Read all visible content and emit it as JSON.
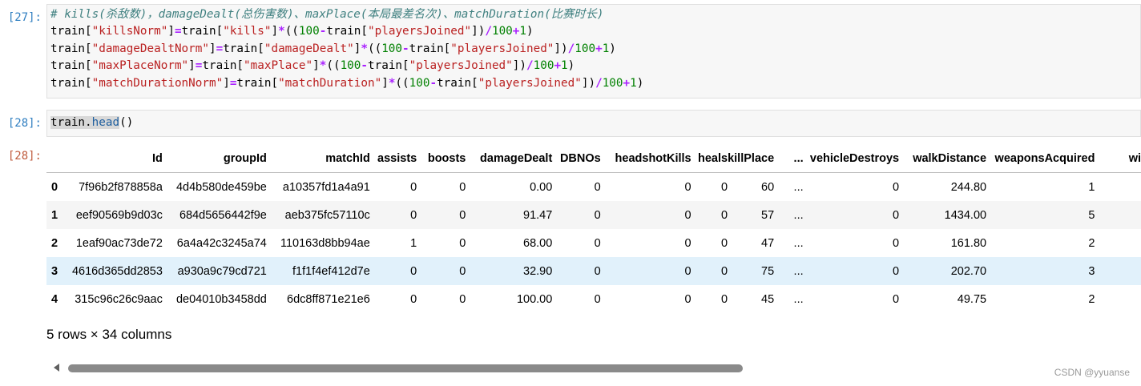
{
  "cells": [
    {
      "prompt": "[27]:",
      "code": [
        [
          [
            "c-com",
            "# kills(杀敌数)，damageDealt(总伤害数)、maxPlace(本局最差名次)、matchDuration(比赛时长)"
          ]
        ],
        [
          [
            "c-name",
            "train["
          ],
          [
            "c-str",
            "\"killsNorm\""
          ],
          [
            "c-name",
            "]"
          ],
          [
            "c-op",
            "="
          ],
          [
            "c-name",
            "train["
          ],
          [
            "c-str",
            "\"kills\""
          ],
          [
            "c-name",
            "]"
          ],
          [
            "c-op",
            "*"
          ],
          [
            "c-name",
            "(("
          ],
          [
            "c-num",
            "100"
          ],
          [
            "c-op",
            "-"
          ],
          [
            "c-name",
            "train["
          ],
          [
            "c-str",
            "\"playersJoined\""
          ],
          [
            "c-name",
            "])"
          ],
          [
            "c-op",
            "/"
          ],
          [
            "c-num",
            "100"
          ],
          [
            "c-op",
            "+"
          ],
          [
            "c-num",
            "1"
          ],
          [
            "c-name",
            ")"
          ]
        ],
        [
          [
            "c-name",
            "train["
          ],
          [
            "c-str",
            "\"damageDealtNorm\""
          ],
          [
            "c-name",
            "]"
          ],
          [
            "c-op",
            "="
          ],
          [
            "c-name",
            "train["
          ],
          [
            "c-str",
            "\"damageDealt\""
          ],
          [
            "c-name",
            "]"
          ],
          [
            "c-op",
            "*"
          ],
          [
            "c-name",
            "(("
          ],
          [
            "c-num",
            "100"
          ],
          [
            "c-op",
            "-"
          ],
          [
            "c-name",
            "train["
          ],
          [
            "c-str",
            "\"playersJoined\""
          ],
          [
            "c-name",
            "])"
          ],
          [
            "c-op",
            "/"
          ],
          [
            "c-num",
            "100"
          ],
          [
            "c-op",
            "+"
          ],
          [
            "c-num",
            "1"
          ],
          [
            "c-name",
            ")"
          ]
        ],
        [
          [
            "c-name",
            "train["
          ],
          [
            "c-str",
            "\"maxPlaceNorm\""
          ],
          [
            "c-name",
            "]"
          ],
          [
            "c-op",
            "="
          ],
          [
            "c-name",
            "train["
          ],
          [
            "c-str",
            "\"maxPlace\""
          ],
          [
            "c-name",
            "]"
          ],
          [
            "c-op",
            "*"
          ],
          [
            "c-name",
            "(("
          ],
          [
            "c-num",
            "100"
          ],
          [
            "c-op",
            "-"
          ],
          [
            "c-name",
            "train["
          ],
          [
            "c-str",
            "\"playersJoined\""
          ],
          [
            "c-name",
            "])"
          ],
          [
            "c-op",
            "/"
          ],
          [
            "c-num",
            "100"
          ],
          [
            "c-op",
            "+"
          ],
          [
            "c-num",
            "1"
          ],
          [
            "c-name",
            ")"
          ]
        ],
        [
          [
            "c-name",
            "train["
          ],
          [
            "c-str",
            "\"matchDurationNorm\""
          ],
          [
            "c-name",
            "]"
          ],
          [
            "c-op",
            "="
          ],
          [
            "c-name",
            "train["
          ],
          [
            "c-str",
            "\"matchDuration\""
          ],
          [
            "c-name",
            "]"
          ],
          [
            "c-op",
            "*"
          ],
          [
            "c-name",
            "(("
          ],
          [
            "c-num",
            "100"
          ],
          [
            "c-op",
            "-"
          ],
          [
            "c-name",
            "train["
          ],
          [
            "c-str",
            "\"playersJoined\""
          ],
          [
            "c-name",
            "])"
          ],
          [
            "c-op",
            "/"
          ],
          [
            "c-num",
            "100"
          ],
          [
            "c-op",
            "+"
          ],
          [
            "c-num",
            "1"
          ],
          [
            "c-name",
            ")"
          ]
        ]
      ]
    },
    {
      "prompt": "[28]:",
      "code_parts": {
        "obj": "train",
        "dot": ".",
        "method": "head",
        "args": "()"
      }
    }
  ],
  "output": {
    "prompt": "[28]:",
    "columns": [
      "Id",
      "groupId",
      "matchId",
      "assists",
      "boosts",
      "damageDealt",
      "DBNOs",
      "headshotKills",
      "heals",
      "killPlace",
      "...",
      "vehicleDestroys",
      "walkDistance",
      "weaponsAcquired",
      "wi"
    ],
    "rows": [
      {
        "index": "0",
        "cells": [
          "7f96b2f878858a",
          "4d4b580de459be",
          "a10357fd1a4a91",
          "0",
          "0",
          "0.00",
          "0",
          "0",
          "0",
          "60",
          "...",
          "0",
          "244.80",
          "1",
          ""
        ]
      },
      {
        "index": "1",
        "cells": [
          "eef90569b9d03c",
          "684d5656442f9e",
          "aeb375fc57110c",
          "0",
          "0",
          "91.47",
          "0",
          "0",
          "0",
          "57",
          "...",
          "0",
          "1434.00",
          "5",
          ""
        ]
      },
      {
        "index": "2",
        "cells": [
          "1eaf90ac73de72",
          "6a4a42c3245a74",
          "110163d8bb94ae",
          "1",
          "0",
          "68.00",
          "0",
          "0",
          "0",
          "47",
          "...",
          "0",
          "161.80",
          "2",
          ""
        ]
      },
      {
        "index": "3",
        "cells": [
          "4616d365dd2853",
          "a930a9c79cd721",
          "f1f1f4ef412d7e",
          "0",
          "0",
          "32.90",
          "0",
          "0",
          "0",
          "75",
          "...",
          "0",
          "202.70",
          "3",
          ""
        ]
      },
      {
        "index": "4",
        "cells": [
          "315c96c26c9aac",
          "de04010b3458dd",
          "6dc8ff871e21e6",
          "0",
          "0",
          "100.00",
          "0",
          "0",
          "0",
          "45",
          "...",
          "0",
          "49.75",
          "2",
          ""
        ]
      }
    ],
    "hover_row": 3,
    "shape_text": "5 rows × 34 columns"
  },
  "watermark": "CSDN @yyuanse",
  "colors": {
    "prompt_in": "#307fc1",
    "prompt_out": "#bf5b3d",
    "row_hover": "#e1f1fb"
  }
}
